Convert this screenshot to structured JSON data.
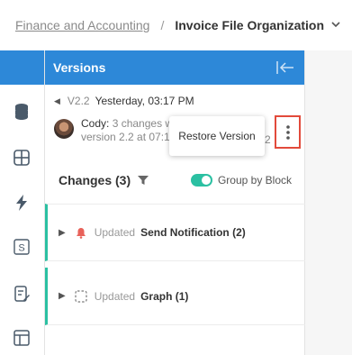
{
  "breadcrumb": {
    "parent": "Finance and Accounting",
    "separator": "/",
    "current": "Invoice File Organization"
  },
  "rail": {
    "icons": [
      "database-icon",
      "grid-icon",
      "lightning-icon",
      "s-box-icon",
      "document-edit-icon",
      "layout-icon"
    ]
  },
  "panel": {
    "title": "Versions",
    "version": {
      "number": "V2.2",
      "date": "Yesterday, 03:17 PM"
    },
    "comment": {
      "author": "Cody:",
      "line1_rest": " 3 changes w",
      "line2": "version 2.2 at 07:1",
      "trail": "2"
    },
    "menu": {
      "restore_label": "Restore Version"
    },
    "changes": {
      "title": "Changes (3)",
      "toggle_label": "Group by Block",
      "toggle_on": true
    },
    "items": [
      {
        "status": "Updated",
        "name": "Send Notification (2)",
        "icon": "bell-icon"
      },
      {
        "status": "Updated",
        "name": "Graph (1)",
        "icon": "dashed-square-icon"
      }
    ]
  },
  "colors": {
    "header_blue": "#2d88d8",
    "accent_teal": "#2bc0a2",
    "highlight_red": "#e24a3b",
    "bell_red": "#e8625a"
  }
}
